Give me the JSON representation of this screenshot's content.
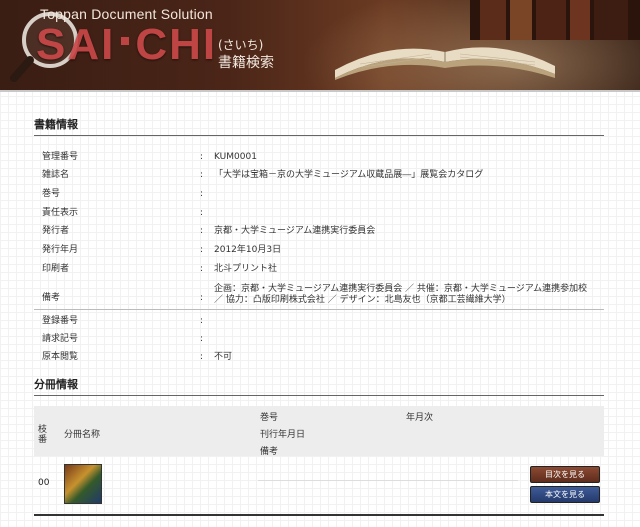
{
  "header": {
    "brand_sub": "Toppan Document Solution",
    "logo_left": "SAI",
    "logo_right": "CHI",
    "reading": "(さいち)",
    "title": "書籍検索"
  },
  "book_info": {
    "title": "書籍情報",
    "rows": [
      {
        "label": "管理番号",
        "value": "KUM0001"
      },
      {
        "label": "雑誌名",
        "value": "「大学は宝箱－京の大学ミュージアム収蔵品展―」展覧会カタログ"
      },
      {
        "label": "巻号",
        "value": ""
      },
      {
        "label": "責任表示",
        "value": ""
      },
      {
        "label": "発行者",
        "value": "京都・大学ミュージアム連携実行委員会"
      },
      {
        "label": "発行年月",
        "value": "2012年10月3日"
      },
      {
        "label": "印刷者",
        "value": "北斗プリント社"
      },
      {
        "label": "備考",
        "value_line1": "企画：京都・大学ミュージアム連携実行委員会 ／ 共催：京都・大学ミュージアム連携参加校",
        "value_line2": "／ 協力：凸版印刷株式会社 ／ デザイン：北島友也（京都工芸繊維大学）"
      }
    ],
    "rows2": [
      {
        "label": "登録番号",
        "value": ""
      },
      {
        "label": "請求記号",
        "value": ""
      },
      {
        "label": "原本閲覧",
        "value": "不可"
      }
    ],
    "colon": ":"
  },
  "volume_info": {
    "title": "分冊情報",
    "headers": {
      "branch_line1": "枝",
      "branch_line2": "番",
      "volume_name": "分冊名称",
      "issue": "巻号",
      "year_month": "年月次",
      "pub_date": "刊行年月日",
      "notes": "備考"
    },
    "rows": [
      {
        "branch": "00",
        "toc_button": "目次を見る",
        "body_button": "本文を見る"
      }
    ]
  },
  "colors": {
    "header_bg": "#4a2518",
    "logo_red": "#c94848",
    "toc_button": "#6b3322",
    "body_button": "#2f4a85"
  }
}
